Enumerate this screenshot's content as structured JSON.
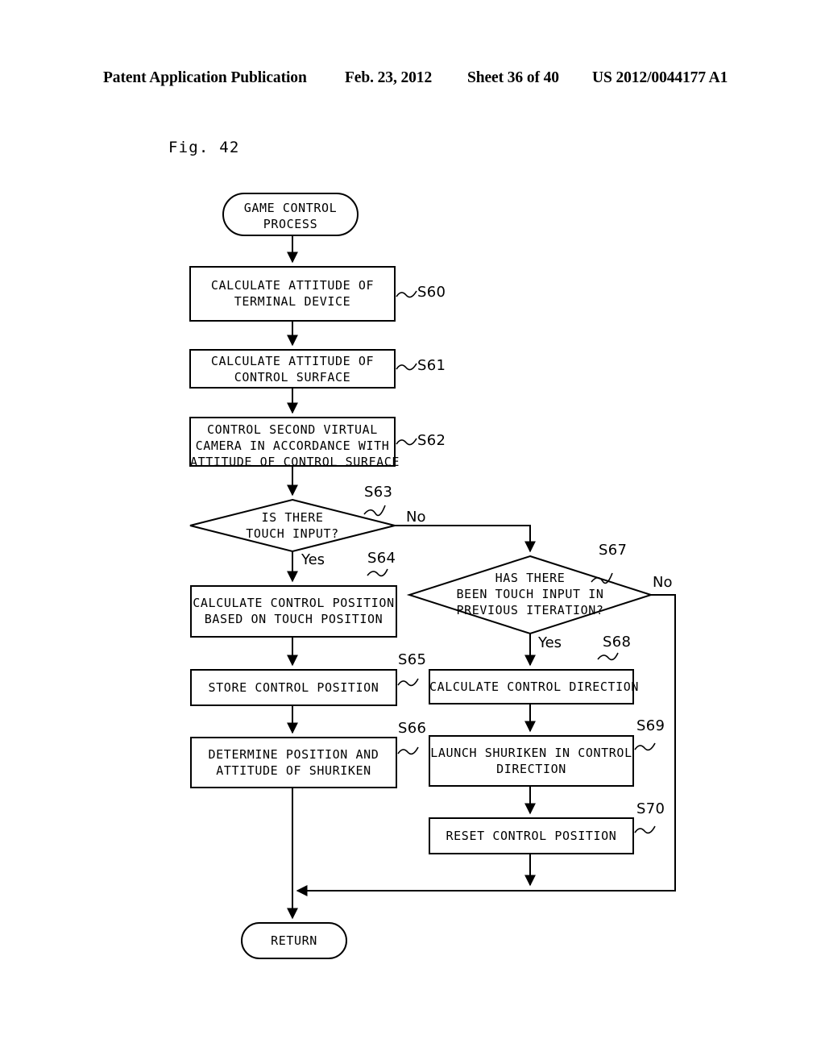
{
  "header": {
    "publication": "Patent Application Publication",
    "date": "Feb. 23, 2012",
    "sheet": "Sheet 36 of 40",
    "number": "US 2012/0044177 A1"
  },
  "figure": {
    "label": "Fig. 42"
  },
  "flowchart": {
    "start": {
      "id": "start",
      "text": "GAME CONTROL\nPROCESS"
    },
    "end": {
      "id": "return",
      "text": "RETURN"
    },
    "steps": [
      {
        "id": "S60",
        "tag": "S60",
        "text": "CALCULATE ATTITUDE OF\nTERMINAL DEVICE"
      },
      {
        "id": "S61",
        "tag": "S61",
        "text": "CALCULATE ATTITUDE OF\nCONTROL SURFACE"
      },
      {
        "id": "S62",
        "tag": "S62",
        "text": "CONTROL SECOND VIRTUAL\nCAMERA IN ACCORDANCE WITH\nATTITUDE OF CONTROL SURFACE"
      },
      {
        "id": "S64",
        "tag": "S64",
        "text": "CALCULATE CONTROL POSITION\nBASED ON TOUCH POSITION"
      },
      {
        "id": "S65",
        "tag": "S65",
        "text": "STORE CONTROL POSITION"
      },
      {
        "id": "S66",
        "tag": "S66",
        "text": "DETERMINE POSITION AND\nATTITUDE OF SHURIKEN"
      },
      {
        "id": "S68",
        "tag": "S68",
        "text": "CALCULATE CONTROL DIRECTION"
      },
      {
        "id": "S69",
        "tag": "S69",
        "text": "LAUNCH SHURIKEN IN CONTROL\nDIRECTION"
      },
      {
        "id": "S70",
        "tag": "S70",
        "text": "RESET CONTROL POSITION"
      }
    ],
    "decisions": [
      {
        "id": "S63",
        "tag": "S63",
        "text": "IS THERE\nTOUCH INPUT?",
        "yes": "Yes",
        "no": "No"
      },
      {
        "id": "S67",
        "tag": "S67",
        "text": "HAS THERE\nBEEN TOUCH INPUT IN\nPREVIOUS ITERATION?",
        "yes": "Yes",
        "no": "No"
      }
    ]
  },
  "colors": {
    "ink": "#000000",
    "paper": "#ffffff"
  }
}
